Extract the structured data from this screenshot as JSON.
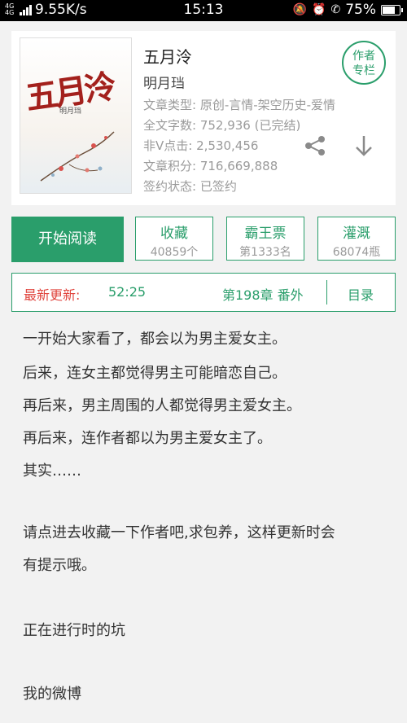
{
  "status_bar": {
    "network_type": "4G 4G",
    "speed": "9.55K/s",
    "time": "15:13",
    "battery": "75%",
    "battery_level": 0.75
  },
  "book": {
    "cover_title": "五月泠",
    "cover_author": "明月珰",
    "title": "五月泠",
    "author": "明月珰",
    "type_line": "文章类型: 原创-言情-架空历史-爱情",
    "words_line": "全文字数: 752,936 (已完结)",
    "clicks_line": "非V点击: 2,530,456",
    "score_line": "文章积分: 716,669,888",
    "sign_line": "签约状态: 已签约",
    "column_badge": [
      "作者",
      "专栏"
    ]
  },
  "actions": {
    "read": "开始阅读",
    "collect": {
      "label": "收藏",
      "value": "40859个"
    },
    "bawang": {
      "label": "霸王票",
      "value": "第1333名"
    },
    "irrigate": {
      "label": "灌溉",
      "value": "68074瓶"
    }
  },
  "update": {
    "label": "最新更新:",
    "time": "52:25",
    "chapter": "第198章 番外",
    "toc": "目录"
  },
  "intro": [
    "一开始大家看了，都会以为男主爱女主。",
    "后来，连女主都觉得男主可能暗恋自己。",
    "再后来，男主周围的人都觉得男主爱女主。",
    "再后来，连作者都以为男主爱女主了。",
    "其实……",
    "请点进去收藏一下作者吧,求包养，这样更新时会",
    "有提示哦。",
    "正在进行时的坑",
    "我的微博"
  ],
  "colors": {
    "accent": "#2a9e6b",
    "highlight": "#e0453e"
  }
}
